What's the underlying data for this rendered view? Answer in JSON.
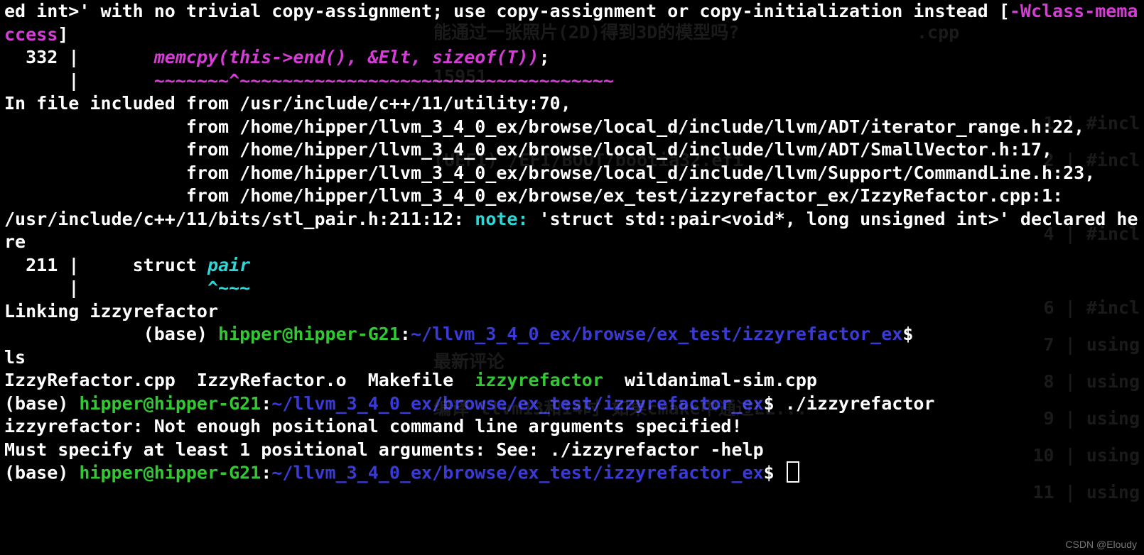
{
  "warn": {
    "head": "ed int>'",
    "msg": " with no trivial copy-assignment; use copy-assignment or copy-initialization instead [",
    "flag": "-Wclass-memaccess",
    "close": "]",
    "lineno": "  332 |       ",
    "code": "memcpy(this->end(), &Elt, sizeof(T))",
    "semi": ";",
    "caretpad": "      |       ",
    "caret": "~~~~~~~^~~~~~~~~~~~~~~~~~~~~~~~~~~~~~~~~~~~"
  },
  "inc": {
    "l1a": "In file included from ",
    "l1b": "/usr/include/c++/11/utility:70",
    "comma": ",",
    "pad": "                 from ",
    "l2b": "/home/hipper/llvm_3_4_0_ex/browse/local_d/include/llvm/ADT/iterator_range.h:22",
    "l3b": "/home/hipper/llvm_3_4_0_ex/browse/local_d/include/llvm/ADT/SmallVector.h:17",
    "l4b": "/home/hipper/llvm_3_4_0_ex/browse/local_d/include/llvm/Support/CommandLine.h:23",
    "l5b": "/home/hipper/llvm_3_4_0_ex/browse/ex_test/izzyrefactor_ex/IzzyRefactor.cpp:1",
    "colon": ":"
  },
  "note": {
    "loc": "/usr/include/c++/11/bits/stl_pair.h:211:12: ",
    "tag": "note:",
    "msg1": " '",
    "type": "struct std::pair<void*, long unsigned int>",
    "msg2": "' declared here",
    "lineno": "  211 |     struct ",
    "code": "pair",
    "caretpad": "      |            ",
    "caret": "^~~~"
  },
  "link": "Linking izzyrefactor",
  "prompt": {
    "gap": "             ",
    "base": "(base) ",
    "userhost": "hipper@hipper-G21",
    "colon": ":",
    "path": "~/llvm_3_4_0_ex/browse/ex_test/izzyrefactor_ex",
    "dollar": "$"
  },
  "ls_cmd": "ls",
  "ls_out": {
    "f1": "IzzyRefactor.cpp  IzzyRefactor.o  Makefile  ",
    "exe": "izzyrefactor",
    "f2": "  wildanimal-sim.cpp"
  },
  "run_cmd": " ./izzyrefactor",
  "err1": "izzyrefactor: Not enough positional command line arguments specified!",
  "err2": "Must specify at least 1 positional arguments: See: ./izzyrefactor -help",
  "watermark": "CSDN @Eloudy",
  "ghost": {
    "title": "能通过一张照片(2D)得到3D的模型吗?",
    "cpp": ".cpp",
    "num": "15951",
    "uefi": "(UEFI)  /EFI/BOOT/bootia32.efi",
    "incl1": "1  | #incl",
    "incl2": "2  | #incl",
    "incl4": "4  | #incl",
    "incl6": "6  | #incl",
    "using7": "7  | using",
    "using8": "8  | using",
    "using9": "9  | using",
    "using10": "10 | using",
    "using11": "11 | using",
    "comments": "最新评论",
    "c1": "编译 llvm13和14时 如果cmake中通过LL..."
  }
}
